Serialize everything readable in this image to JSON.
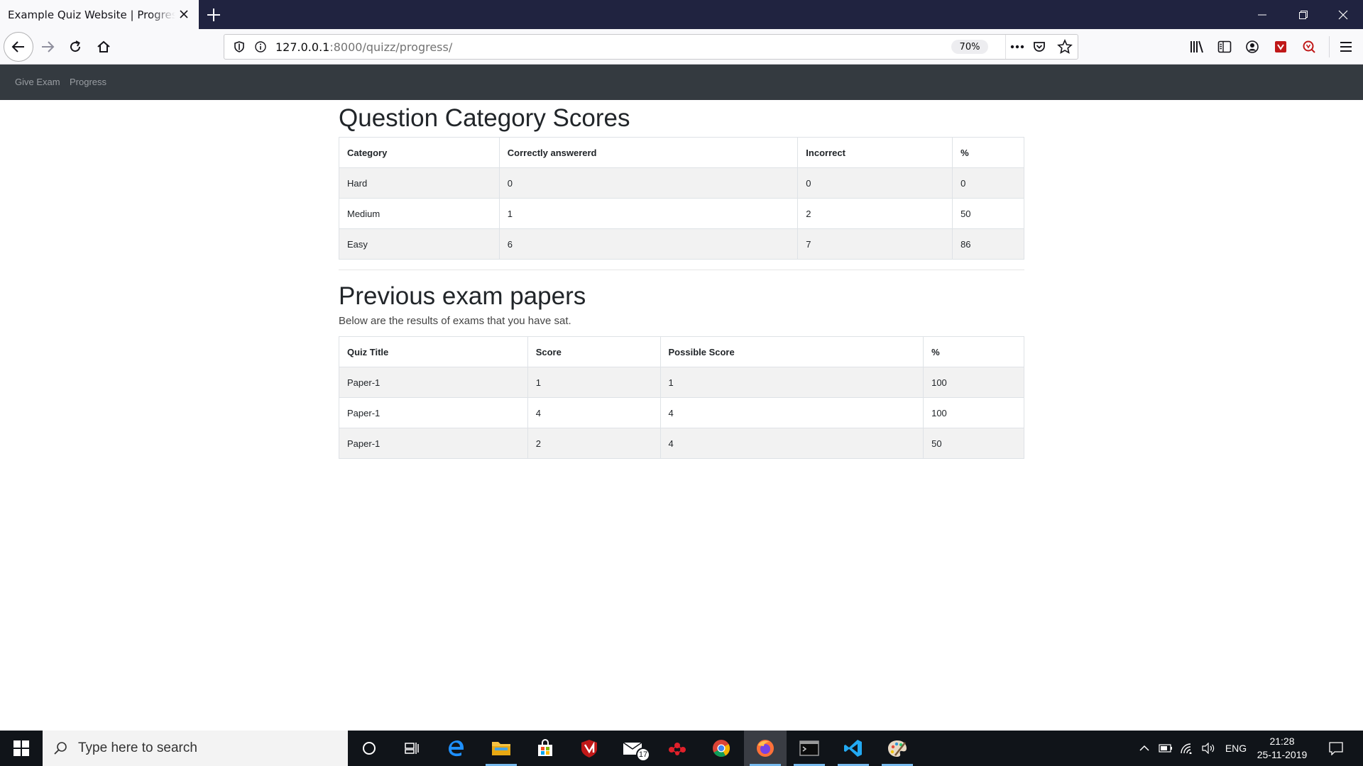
{
  "browser": {
    "tab_title": "Example Quiz Website | Progress Page",
    "url_host": "127.0.0.1",
    "url_rest": ":8000/quizz/progress/",
    "zoom": "70%"
  },
  "site_nav": {
    "items": [
      "Give Exam",
      "Progress"
    ]
  },
  "category_scores": {
    "title": "Question Category Scores",
    "headers": [
      "Category",
      "Correctly answererd",
      "Incorrect",
      "%"
    ],
    "rows": [
      [
        "Hard",
        "0",
        "0",
        "0"
      ],
      [
        "Medium",
        "1",
        "2",
        "50"
      ],
      [
        "Easy",
        "6",
        "7",
        "86"
      ]
    ]
  },
  "previous_exams": {
    "title": "Previous exam papers",
    "subtitle": "Below are the results of exams that you have sat.",
    "headers": [
      "Quiz Title",
      "Score",
      "Possible Score",
      "%"
    ],
    "rows": [
      [
        "Paper-1",
        "1",
        "1",
        "100"
      ],
      [
        "Paper-1",
        "4",
        "4",
        "100"
      ],
      [
        "Paper-1",
        "2",
        "4",
        "50"
      ]
    ]
  },
  "taskbar": {
    "search_placeholder": "Type here to search",
    "mail_badge": "17",
    "language": "ENG",
    "time": "21:28",
    "date": "25-11-2019"
  }
}
